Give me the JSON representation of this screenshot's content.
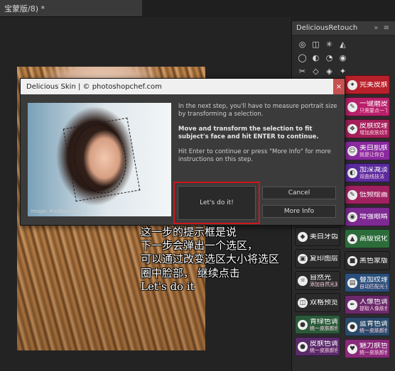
{
  "window": {
    "doc_tab": "宝蒙版/8) *"
  },
  "panel": {
    "title": "DeliciousRetouch",
    "controls": "»  ≡",
    "tools": [
      "◎",
      "◫",
      "✳",
      "◭",
      "◯",
      "◐",
      "◔",
      "◉",
      "✂",
      "◇",
      "◈",
      "✦",
      "✎",
      "▢",
      "◒",
      "▲"
    ],
    "right_buttons": [
      {
        "label": "完美皮肤",
        "sub": "",
        "color": "#b8202b",
        "icon": "spark-icon",
        "glyph": "✦"
      },
      {
        "label": "一键磨皮",
        "sub": "只需要点一下",
        "color": "#b8206a",
        "icon": "brush-icon",
        "glyph": "✎"
      },
      {
        "label": "皮肤纹理",
        "sub": "增加皮肤纹理",
        "color": "#a51f5a",
        "icon": "texture-icon",
        "glyph": "❖"
      },
      {
        "label": "美白肌肤",
        "sub": "就是让你白",
        "color": "#8a2aa0",
        "icon": "face-icon",
        "glyph": "☺"
      },
      {
        "label": "加深减淡",
        "sub": "双曲线技法",
        "color": "#5b2a9e",
        "icon": "contrast-icon",
        "glyph": "◐"
      },
      {
        "label": "低频绘画",
        "sub": "",
        "color": "#a02160",
        "icon": "paint-icon",
        "glyph": "✎"
      },
      {
        "label": "增强眼睛",
        "sub": "",
        "color": "#7d2a92",
        "icon": "eye-icon",
        "glyph": "◉"
      },
      {
        "label": "高级锐化",
        "sub": "",
        "color": "#2c6b3a",
        "icon": "triangle-icon",
        "glyph": "▲"
      },
      {
        "label": "黑色蒙版",
        "sub": "",
        "color": "#2b2b2b",
        "icon": "mask-icon",
        "glyph": "■"
      },
      {
        "label": "叠加纹理",
        "sub": "自动匹配光子",
        "color": "#2a4f7a",
        "icon": "layers-icon",
        "glyph": "▤"
      },
      {
        "label": "人像色调",
        "sub": "提取人像肤色",
        "color": "#6a2a6a",
        "icon": "pen-icon",
        "glyph": "✒"
      },
      {
        "label": "蓝青色调",
        "sub": "统一皮肤颜色",
        "color": "#2a4a6a",
        "icon": "drop-icon",
        "glyph": "●"
      },
      {
        "label": "魅力肤色",
        "sub": "统一皮肤颜色",
        "color": "#8a2a7a",
        "icon": "heart-icon",
        "glyph": "♥"
      }
    ],
    "left_buttons": [
      {
        "label": "美白牙齿",
        "sub": "",
        "color": "#2b2b2b",
        "icon": "tooth-icon",
        "glyph": "◆"
      },
      {
        "label": "复印图层",
        "sub": "",
        "color": "#2b2b2b",
        "icon": "copy-icon",
        "glyph": "▣"
      },
      {
        "label": "自然光",
        "sub": "添加自然光源",
        "color": "#2b2b2b",
        "icon": "sun-icon",
        "glyph": "☼"
      },
      {
        "label": "双格预览",
        "sub": "",
        "color": "#2b2b2b",
        "icon": "split-icon",
        "glyph": "◫"
      },
      {
        "label": "青绿色调",
        "sub": "统一皮肤颜色",
        "color": "#2b5a3a",
        "icon": "drop-icon",
        "glyph": "●"
      },
      {
        "label": "皮肤色调",
        "sub": "统一皮肤颜色",
        "color": "#5a2a6a",
        "icon": "drop-icon",
        "glyph": "●"
      }
    ]
  },
  "dialog": {
    "title": "Delicious Skin | © photoshopchef.com",
    "close_glyph": "×",
    "credit": "Image: PixaBay.com",
    "text1": "In the next step, you'll have to measure portrait size by transforming a selection.",
    "text2": "Move and transform the selection to fit subject's face and hit ENTER to continue.",
    "text3": "Hit Enter to continue or press \"More Info\" for more instructions on this step.",
    "primary_label": "Let's do it!",
    "cancel_label": "Cancel",
    "more_info_label": "More Info"
  },
  "annotation": [
    "这一步的提示框是说",
    "下一步会弹出一个选区，",
    "可以通过改变选区大小将选区",
    "圈中脸部， 继续点击",
    "Let's do it"
  ]
}
